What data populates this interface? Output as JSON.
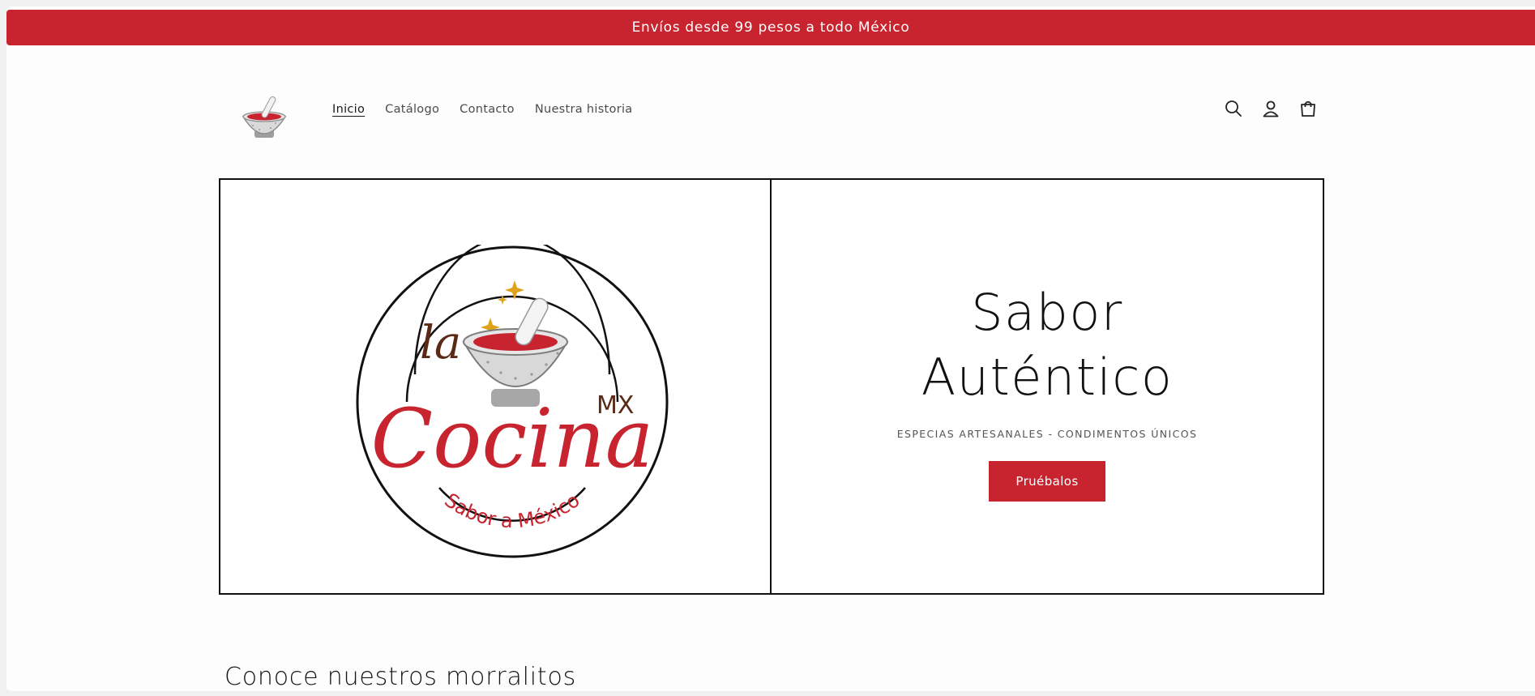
{
  "announcement": {
    "text": "Envíos desde 99 pesos a todo México"
  },
  "brand": {
    "accent_color": "#c8242f",
    "logo_icon": "molcajete-icon",
    "hero_logo": {
      "line1": "la",
      "line2": "Cocina",
      "badge": "MX",
      "tagline": "Sabor a México"
    }
  },
  "nav": {
    "items": [
      {
        "label": "Inicio",
        "active": true
      },
      {
        "label": "Catálogo",
        "active": false
      },
      {
        "label": "Contacto",
        "active": false
      },
      {
        "label": "Nuestra historia",
        "active": false
      }
    ]
  },
  "header_icons": {
    "search": "search-icon",
    "account": "account-icon",
    "cart": "cart-icon"
  },
  "hero": {
    "title_line1": "Sabor",
    "title_line2": "Auténtico",
    "subtitle": "ESPECIAS ARTESANALES - CONDIMENTOS ÚNICOS",
    "cta_label": "Pruébalos"
  },
  "collection": {
    "title": "Conoce nuestros morralitos"
  }
}
